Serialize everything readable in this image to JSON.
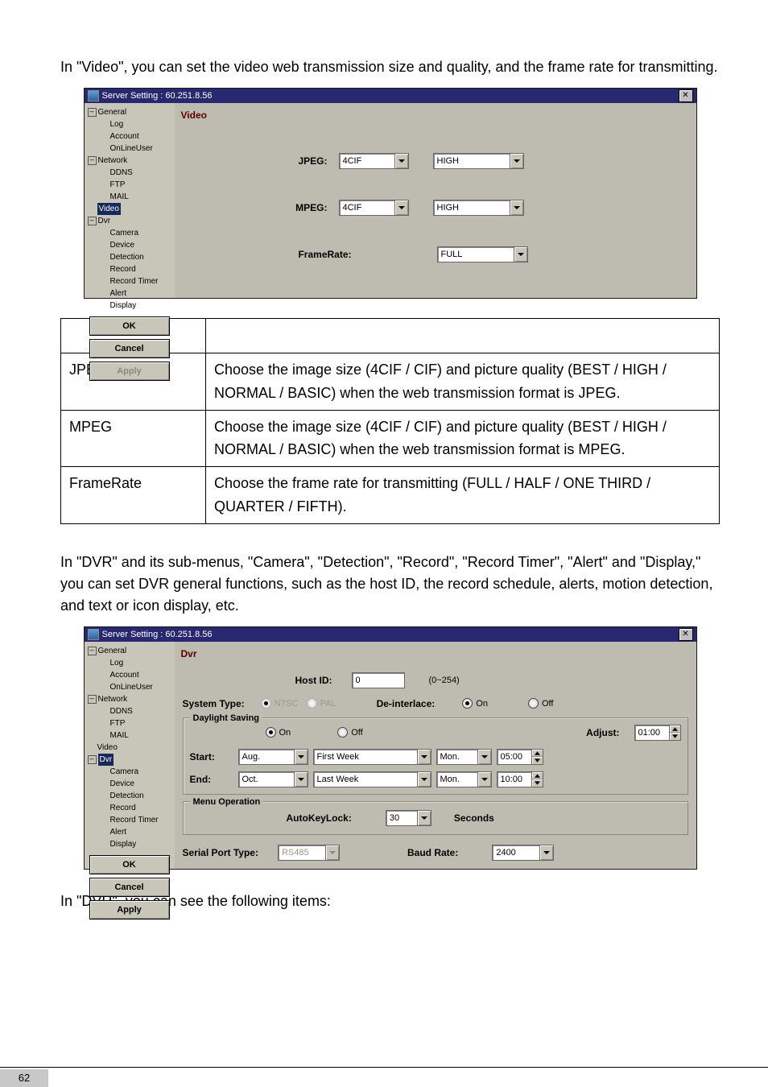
{
  "intro1": "In \"Video\", you can set the video web transmission size and quality, and the frame rate for transmitting.",
  "fig1": {
    "title": "Server Setting : 60.251.8.56",
    "tree": {
      "general": "General",
      "log": "Log",
      "account": "Account",
      "onlineuser": "OnLineUser",
      "network": "Network",
      "ddns": "DDNS",
      "ftp": "FTP",
      "mail": "MAIL",
      "video": "Video",
      "dvr": "Dvr",
      "camera": "Camera",
      "device": "Device",
      "detection": "Detection",
      "record": "Record",
      "recordtimer": "Record Timer",
      "alert": "Alert",
      "display": "Display"
    },
    "buttons": {
      "ok": "OK",
      "cancel": "Cancel",
      "apply": "Apply"
    },
    "panelHeader": "Video",
    "jpegLabel": "JPEG:",
    "mpegLabel": "MPEG:",
    "frameLabel": "FrameRate:",
    "jpegSize": "4CIF",
    "jpegQual": "HIGH",
    "mpegSize": "4CIF",
    "mpegQual": "HIGH",
    "frameVal": "FULL"
  },
  "table": {
    "rows": [
      {
        "k": "JPEG",
        "v": "Choose the image size (4CIF / CIF) and picture quality (BEST / HIGH / NORMAL / BASIC) when the web transmission format is JPEG."
      },
      {
        "k": "MPEG",
        "v": "Choose the image size (4CIF / CIF) and picture quality (BEST / HIGH / NORMAL / BASIC) when the web transmission format is MPEG."
      },
      {
        "k": "FrameRate",
        "v": "Choose the frame rate for transmitting (FULL / HALF / ONE THIRD / QUARTER / FIFTH)."
      }
    ]
  },
  "intro2": "In \"DVR\" and its sub-menus, \"Camera\", \"Detection\", \"Record\", \"Record Timer\", \"Alert\" and \"Display,\" you can set DVR general functions, such as the host ID, the record schedule, alerts, motion detection, and text or icon display, etc.",
  "fig2": {
    "title": "Server Setting : 60.251.8.56",
    "tree": {
      "general": "General",
      "log": "Log",
      "account": "Account",
      "onlineuser": "OnLineUser",
      "network": "Network",
      "ddns": "DDNS",
      "ftp": "FTP",
      "mail": "MAIL",
      "video": "Video",
      "dvr": "Dvr",
      "camera": "Camera",
      "device": "Device",
      "detection": "Detection",
      "record": "Record",
      "recordtimer": "Record Timer",
      "alert": "Alert",
      "display": "Display"
    },
    "buttons": {
      "ok": "OK",
      "cancel": "Cancel",
      "apply": "Apply"
    },
    "panelHeader": "Dvr",
    "hostIdLabel": "Host ID:",
    "hostIdVal": "0",
    "hostIdHint": "(0~254)",
    "sysTypeLabel": "System Type:",
    "sysNtsc": "NTSC",
    "sysPal": "PAL",
    "deintLabel": "De-interlace:",
    "onLabel": "On",
    "offLabel": "Off",
    "dsLegend": "Daylight Saving",
    "adjustLabel": "Adjust:",
    "adjustVal": "01:00",
    "startLabel": "Start:",
    "startMonth": "Aug.",
    "startWeek": "First Week",
    "startDay": "Mon.",
    "startTime": "05:00",
    "endLabel": "End:",
    "endMonth": "Oct.",
    "endWeek": "Last Week",
    "endDay": "Mon.",
    "endTime": "10:00",
    "menuLegend": "Menu Operation",
    "autoKeyLabel": "AutoKeyLock:",
    "autoKeyVal": "30",
    "secondsLabel": "Seconds",
    "serialLabel": "Serial Port Type:",
    "serialVal": "RS485",
    "baudLabel": "Baud Rate:",
    "baudVal": "2400"
  },
  "intro3": "In \"DVR\", you can see the following items:",
  "pageNumber": "62"
}
